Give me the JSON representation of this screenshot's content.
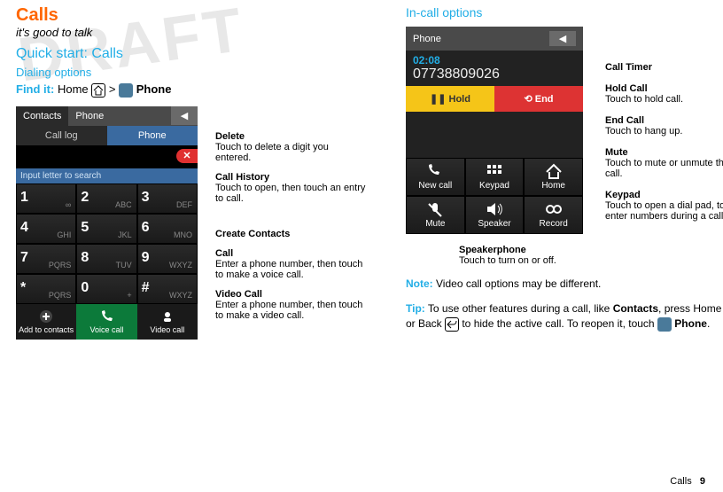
{
  "left": {
    "title": "Calls",
    "tagline": "it's good to talk",
    "quickstart": "Quick start: Calls",
    "dialing": "Dialing options",
    "find_label": "Find it:",
    "find_path_home": "Home",
    "find_path_gt": ">",
    "find_path_phone": "Phone",
    "titlebar": {
      "contacts": "Contacts",
      "phone": "Phone"
    },
    "subtabs": {
      "calllog": "Call log",
      "phone": "Phone"
    },
    "searchbar": "Input letter to search",
    "keypad": [
      {
        "num": "1",
        "let": "∞"
      },
      {
        "num": "2",
        "let": "ABC"
      },
      {
        "num": "3",
        "let": "DEF"
      },
      {
        "num": "4",
        "let": "GHI"
      },
      {
        "num": "5",
        "let": "JKL"
      },
      {
        "num": "6",
        "let": "MNO"
      },
      {
        "num": "7",
        "let": "PQRS"
      },
      {
        "num": "8",
        "let": "TUV"
      },
      {
        "num": "9",
        "let": "WXYZ"
      },
      {
        "num": "*",
        "let": "PQRS"
      },
      {
        "num": "0",
        "let": "+"
      },
      {
        "num": "#",
        "let": "WXYZ"
      }
    ],
    "actions": {
      "add": "Add to contacts",
      "voice": "Voice call",
      "video": "Video call"
    },
    "callouts": {
      "delete": {
        "t": "Delete",
        "d": "Touch to delete a digit you entered."
      },
      "history": {
        "t": "Call History",
        "d": "Touch to open, then touch an entry to call."
      },
      "create": {
        "t": "Create Contacts",
        "d": ""
      },
      "call": {
        "t": "Call",
        "d": "Enter a phone number, then touch to make a voice call."
      },
      "video": {
        "t": "Video Call",
        "d": "Enter a phone number, then touch to make a video call."
      }
    }
  },
  "right": {
    "heading": "In-call options",
    "titlebar": "Phone",
    "timer": "02:08",
    "number": "07738809026",
    "hold": "Hold",
    "end": "End",
    "grid": {
      "newcall": "New call",
      "keypad": "Keypad",
      "home": "Home",
      "mute": "Mute",
      "speaker": "Speaker",
      "record": "Record"
    },
    "callouts": {
      "timer": {
        "t": "Call Timer",
        "d": ""
      },
      "hold": {
        "t": "Hold Call",
        "d": "Touch to hold call."
      },
      "end": {
        "t": "End Call",
        "d": "Touch to hang up."
      },
      "mute": {
        "t": "Mute",
        "d": "Touch to mute or unmute the call."
      },
      "keypad": {
        "t": "Keypad",
        "d": "Touch to open a dial pad, to enter numbers during a call."
      },
      "speaker": {
        "t": "Speakerphone",
        "d": "Touch to turn on or off."
      }
    },
    "note_label": "Note:",
    "note_text": "Video call options may be different.",
    "tip_label": "Tip:",
    "tip_text_a": "To use other features during a call, like ",
    "tip_bold": "Contacts",
    "tip_text_b": ", press Home ",
    "tip_text_c": " or Back ",
    "tip_text_d": " to hide the active call. To reopen it, touch ",
    "tip_phone": "Phone",
    "tip_text_e": "."
  },
  "footer": {
    "section": "Calls",
    "page": "9"
  }
}
